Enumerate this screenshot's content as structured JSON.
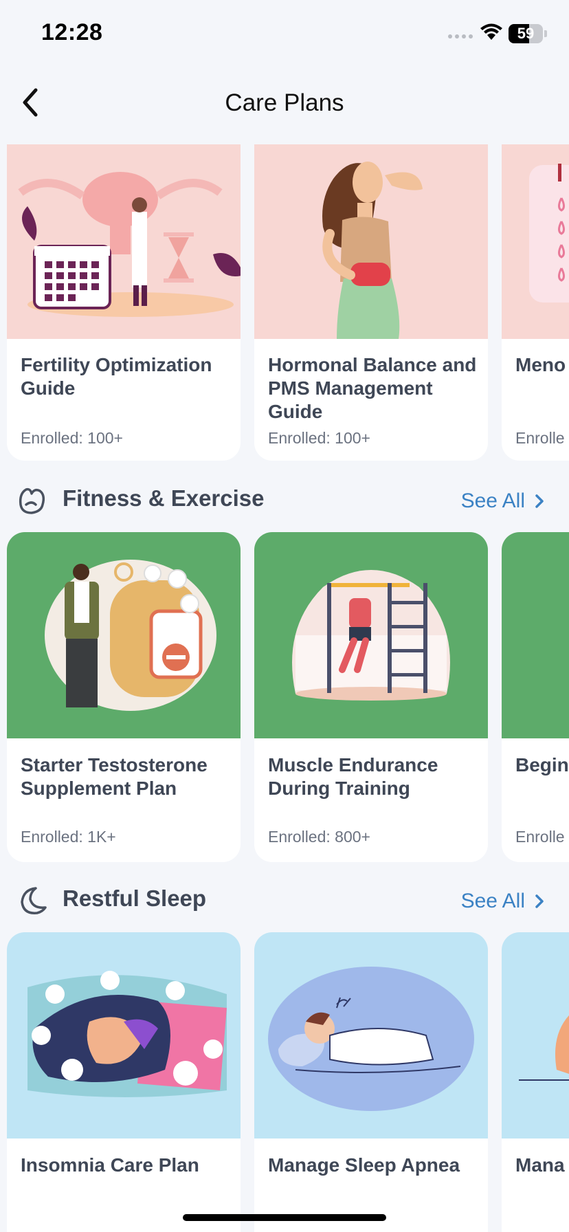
{
  "status_bar": {
    "time": "12:28",
    "battery": "59"
  },
  "header": {
    "title": "Care Plans"
  },
  "top_row": [
    {
      "title": "Fertility Optimization Guide",
      "enrolled": "Enrolled: 100+"
    },
    {
      "title": "Hormonal Balance and PMS Management Guide",
      "enrolled": "Enrolled: 100+"
    },
    {
      "title": "Meno Mana",
      "enrolled": "Enrolle"
    }
  ],
  "fitness": {
    "title": "Fitness & Exercise",
    "see_all": "See All",
    "cards": [
      {
        "title": "Starter Testosterone Supplement Plan",
        "enrolled": "Enrolled: 1K+"
      },
      {
        "title": "Muscle Endurance During Training",
        "enrolled": "Enrolled: 800+"
      },
      {
        "title": "Begin Traini",
        "enrolled": "Enrolle"
      }
    ]
  },
  "sleep": {
    "title": "Restful Sleep",
    "see_all": "See All",
    "cards": [
      {
        "title": "Insomnia Care Plan"
      },
      {
        "title": "Manage Sleep Apnea"
      },
      {
        "title": "Mana"
      }
    ]
  },
  "colors": {
    "pink_bg": "#f8d7d3",
    "green_bg": "#5dab6a",
    "blue_bg": "#bfe5f5",
    "link": "#3b82c4"
  },
  "icons": {
    "back": "chevron-left-icon",
    "fitness": "heart-hand-icon",
    "sleep": "moon-icon",
    "see_all": "chevron-right-icon"
  }
}
